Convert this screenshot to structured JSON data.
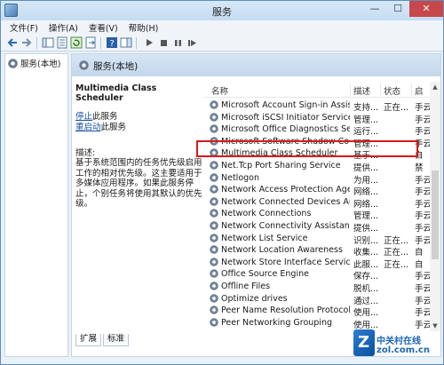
{
  "window": {
    "title": "服务",
    "minimize": "—",
    "maximize": "☐",
    "close": "✕"
  },
  "menu": [
    "文件(F)",
    "操作(A)",
    "查看(V)",
    "帮助(H)"
  ],
  "tree": {
    "item": "服务(本地)"
  },
  "main": {
    "title": "服务(本地)"
  },
  "description": {
    "service_name": "Multimedia Class Scheduler",
    "stop_link": "停止",
    "stop_suffix": "此服务",
    "restart_link": "重启动",
    "restart_suffix": "此服务",
    "label": "描述:",
    "text": "基于系统范围内的任务优先级启用工作的相对优先级。这主要适用于多媒体应用程序。如果此服务停止，个别任务将使用其默认的优先级。"
  },
  "list": {
    "columns": [
      "名称",
      "描述",
      "状态",
      "启"
    ],
    "rows": [
      {
        "name": "Microsoft Account Sign-in Assist...",
        "desc": "支持...",
        "status": "正在...",
        "start": "手云"
      },
      {
        "name": "Microsoft iSCSI Initiator Service",
        "desc": "管理...",
        "status": "",
        "start": "手云"
      },
      {
        "name": "Microsoft Office Diagnostics Ser...",
        "desc": "运行...",
        "status": "",
        "start": "手云"
      },
      {
        "name": "Microsoft Software Shadow Cop...",
        "desc": "管理...",
        "status": "",
        "start": "手云"
      },
      {
        "name": "Multimedia Class Scheduler",
        "desc": "基于...",
        "status": "",
        "start": "自"
      },
      {
        "name": "Net.Tcp Port Sharing Service",
        "desc": "提供...",
        "status": "",
        "start": "禁"
      },
      {
        "name": "Netlogon",
        "desc": "为用...",
        "status": "",
        "start": "手云"
      },
      {
        "name": "Network Access Protection Agent",
        "desc": "网络...",
        "status": "",
        "start": "手云"
      },
      {
        "name": "Network Connected Devices Aut...",
        "desc": "网络...",
        "status": "",
        "start": "手云"
      },
      {
        "name": "Network Connections",
        "desc": "管理...",
        "status": "",
        "start": "手云"
      },
      {
        "name": "Network Connectivity Assistant",
        "desc": "提供...",
        "status": "",
        "start": "手云"
      },
      {
        "name": "Network List Service",
        "desc": "识别...",
        "status": "正在...",
        "start": "手云"
      },
      {
        "name": "Network Location Awareness",
        "desc": "收集...",
        "status": "正在...",
        "start": "自"
      },
      {
        "name": "Network Store Interface Service",
        "desc": "此服...",
        "status": "正在...",
        "start": "自"
      },
      {
        "name": "Office Source Engine",
        "desc": "保存...",
        "status": "",
        "start": "手云"
      },
      {
        "name": "Offline Files",
        "desc": "脱机...",
        "status": "",
        "start": "手云"
      },
      {
        "name": "Optimize drives",
        "desc": "通过...",
        "status": "",
        "start": "手云"
      },
      {
        "name": "Peer Name Resolution Protocol",
        "desc": "使用...",
        "status": "",
        "start": "手云"
      },
      {
        "name": "Peer Networking Grouping",
        "desc": "使用...",
        "status": "",
        "start": "手云"
      }
    ]
  },
  "tabs": [
    "扩展",
    "标准"
  ],
  "watermark": {
    "line1": "中关村在线",
    "line2": "zol.com.cn"
  }
}
